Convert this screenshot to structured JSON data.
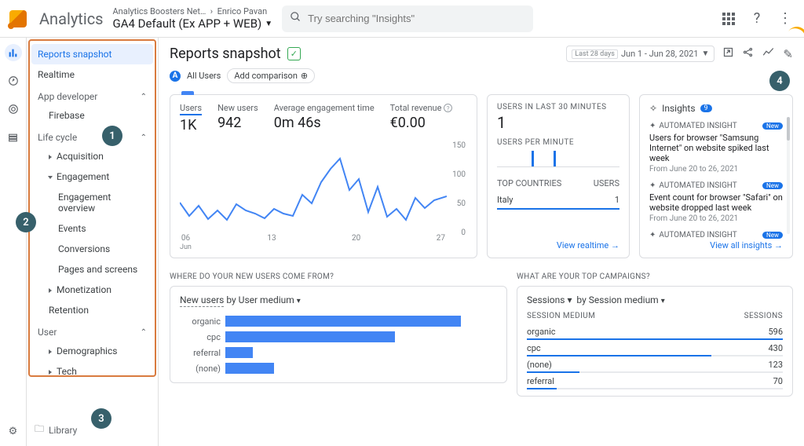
{
  "header": {
    "brand": "Analytics",
    "crumb1": "Analytics Boosters Net…",
    "crumb2": "Enrico Pavan",
    "view_name": "GA4 Default (Ex APP + WEB)",
    "search_placeholder": "Try searching \"Insights\""
  },
  "sidebar": {
    "items_top": [
      "Reports snapshot",
      "Realtime"
    ],
    "group_app": {
      "label": "App developer",
      "items": [
        "Firebase"
      ]
    },
    "group_life": {
      "label": "Life cycle",
      "items": [
        "Acquisition",
        "Engagement",
        "Monetization",
        "Retention"
      ],
      "engagement_sub": [
        "Engagement overview",
        "Events",
        "Conversions",
        "Pages and screens"
      ]
    },
    "group_user": {
      "label": "User",
      "items": [
        "Demographics",
        "Tech"
      ]
    },
    "library": "Library"
  },
  "page": {
    "title": "Reports snapshot",
    "date_prefix": "Last 28 days",
    "date_range": "Jun 1 - Jun 28, 2021",
    "all_users": "All Users",
    "add_comparison": "Add comparison"
  },
  "kpi": {
    "metrics": [
      {
        "label": "Users",
        "value": "1K"
      },
      {
        "label": "New users",
        "value": "942"
      },
      {
        "label": "Average engagement time",
        "value": "0m 46s"
      },
      {
        "label": "Total revenue",
        "value": "€0.00"
      }
    ],
    "y_ticks": [
      "150",
      "100",
      "50",
      "0"
    ],
    "x_ticks": [
      "06",
      "13",
      "20",
      "27"
    ],
    "x_sub": "Jun"
  },
  "realtime": {
    "label": "USERS IN LAST 30 MINUTES",
    "value": "1",
    "per_min": "USERS PER MINUTE",
    "country_head": "TOP COUNTRIES",
    "users_head": "USERS",
    "rows": [
      {
        "c": "Italy",
        "v": "1"
      }
    ],
    "link": "View realtime"
  },
  "insights": {
    "head": "Insights",
    "count": "9",
    "tag": "AUTOMATED INSIGHT",
    "new": "New",
    "items": [
      {
        "title": "Users for browser \"Samsung Internet\" on website spiked last week",
        "date": "From June 20 to 26, 2021"
      },
      {
        "title": "Event count for browser \"Safari\" on website dropped last week",
        "date": "From June 20 to 26, 2021"
      },
      {
        "title": "",
        "date": ""
      }
    ],
    "link": "View all insights"
  },
  "new_users": {
    "section": "WHERE DO YOUR NEW USERS COME FROM?",
    "metric_a": "New users",
    "by": "by User medium"
  },
  "campaigns": {
    "section": "WHAT ARE YOUR TOP CAMPAIGNS?",
    "metric_a": "Sessions",
    "by": "by Session medium",
    "col_a": "SESSION MEDIUM",
    "col_b": "SESSIONS",
    "rows": [
      {
        "m": "organic",
        "v": 596
      },
      {
        "m": "cpc",
        "v": 430
      },
      {
        "m": "(none)",
        "v": 123
      },
      {
        "m": "referral",
        "v": 70
      }
    ]
  },
  "chart_data": {
    "type": "bar",
    "categories": [
      "organic",
      "cpc",
      "referral",
      "(none)"
    ],
    "values": [
      596,
      430,
      70,
      123
    ],
    "xlabel": "",
    "ylabel": "New users"
  },
  "annotations": {
    "1": "1",
    "2": "2",
    "3": "3",
    "4": "4"
  }
}
